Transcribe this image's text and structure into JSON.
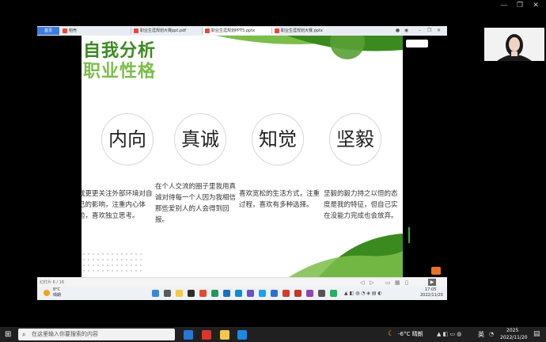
{
  "window": {
    "minimize": "—",
    "restore": "❐",
    "close": "✕"
  },
  "browser": {
    "tabs": [
      {
        "label": "首页"
      },
      {
        "label": "稻壳"
      },
      {
        "label": "职业生涯规划大赛ppt.pdf"
      },
      {
        "label": "职业生涯规划PPT5.pptx"
      },
      {
        "label": "职业生涯规划大赛.pptx"
      }
    ]
  },
  "slide": {
    "title_line1": "自我分析",
    "title_line2": "职业性格",
    "traits": [
      {
        "word": "内向",
        "desc": "我更更关注外部环境对自己的影响，注重内心体验，喜欢独立思考。"
      },
      {
        "word": "真诚",
        "desc": "在个人交流的圈子里我用真诚对待每一个人因为我相信那些爱别人的人会得到回报。"
      },
      {
        "word": "知觉",
        "desc": "喜欢宽松的生活方式，注重过程，喜欢有多种选择。"
      },
      {
        "word": "坚毅",
        "desc": "坚毅的毅力持之以恒的态度是我的特征，但自己实在没能力完成也会放弃。"
      }
    ]
  },
  "status": {
    "page": "幻灯片 6 / 16"
  },
  "inner_taskbar": {
    "weather_temp": "8°C",
    "weather_text": "晴朗",
    "time": "17:05",
    "date": "2022/11/20"
  },
  "host_taskbar": {
    "search_placeholder": "在这里输入你要搜索的内容",
    "weather": "-6°C 晴朗",
    "lang": "英",
    "time": "2025",
    "date": "2022/11/20"
  },
  "colors": {
    "green_dark": "#3a8a1f",
    "green_light": "#7dbd4a",
    "tab_active": "#3d7de0"
  }
}
